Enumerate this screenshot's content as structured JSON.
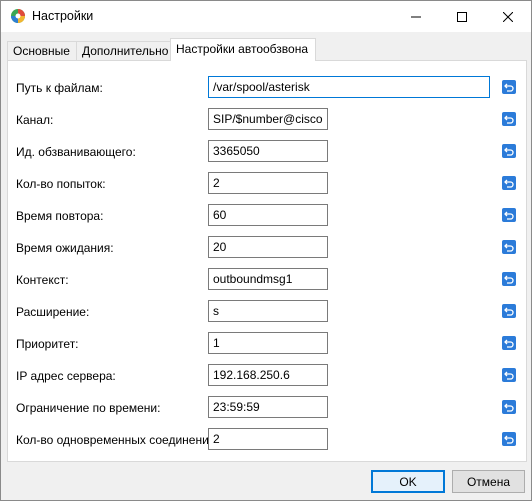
{
  "window": {
    "title": "Настройки",
    "icon": "app-logo-icon"
  },
  "tabs": [
    {
      "label": "Основные",
      "active": false
    },
    {
      "label": "Дополнительно",
      "active": false
    },
    {
      "label": "Настройки автообзвона",
      "active": true
    }
  ],
  "fields": [
    {
      "label": "Путь к файлам:",
      "value": "/var/spool/asterisk"
    },
    {
      "label": "Канал:",
      "value": "SIP/$number@cisco"
    },
    {
      "label": "Ид. обзванивающего:",
      "value": "3365050"
    },
    {
      "label": "Кол-во попыток:",
      "value": "2"
    },
    {
      "label": "Время повтора:",
      "value": "60"
    },
    {
      "label": "Время ожидания:",
      "value": "20"
    },
    {
      "label": "Контекст:",
      "value": "outboundmsg1"
    },
    {
      "label": "Расширение:",
      "value": "s"
    },
    {
      "label": "Приоритет:",
      "value": "1"
    },
    {
      "label": "IP адрес сервера:",
      "value": "192.168.250.6"
    },
    {
      "label": "Ограничение по времени:",
      "value": "23:59:59"
    },
    {
      "label": "Кол-во одновременных соединений:",
      "value": "2"
    }
  ],
  "buttons": {
    "ok": "OK",
    "cancel": "Отмена"
  },
  "colors": {
    "accent": "#0078d7",
    "reset_icon": "#2b7bd9"
  }
}
